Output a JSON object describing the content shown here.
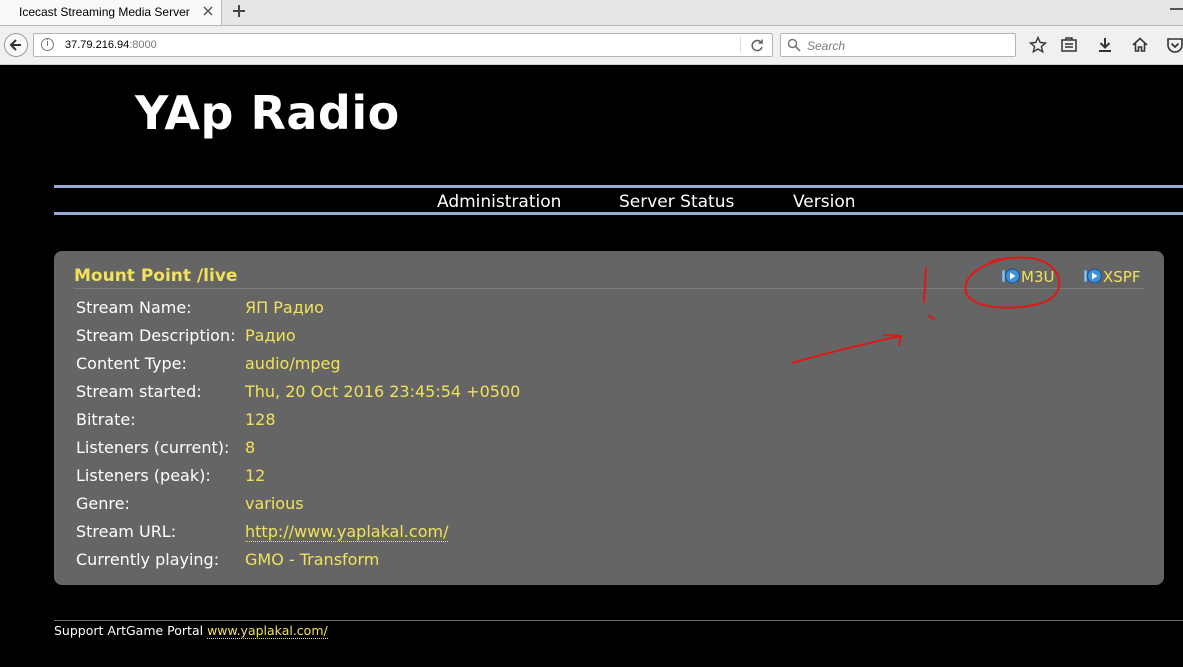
{
  "browser": {
    "tab_title": "Icecast Streaming Media Server",
    "url_host": "37.79.216.94",
    "url_port": ":8000",
    "search_placeholder": "Search"
  },
  "site": {
    "title": "YAp Radio",
    "nav": {
      "administration": "Administration",
      "server_status": "Server Status",
      "version": "Version"
    }
  },
  "mount": {
    "title": "Mount Point /live",
    "m3u_label": "M3U",
    "xspf_label": "XSPF",
    "rows": [
      {
        "label": "Stream Name:",
        "value": "ЯП Радио"
      },
      {
        "label": "Stream Description:",
        "value": "Радио"
      },
      {
        "label": "Content Type:",
        "value": "audio/mpeg"
      },
      {
        "label": "Stream started:",
        "value": "Thu, 20 Oct 2016 23:45:54 +0500"
      },
      {
        "label": "Bitrate:",
        "value": "128"
      },
      {
        "label": "Listeners (current):",
        "value": "8"
      },
      {
        "label": "Listeners (peak):",
        "value": "12"
      },
      {
        "label": "Genre:",
        "value": "various"
      },
      {
        "label": "Stream URL:",
        "value": "http://www.yaplakal.com/"
      },
      {
        "label": "Currently playing:",
        "value": "GMO - Transform"
      }
    ]
  },
  "footer": {
    "text": "Support ArtGame Portal ",
    "link": "www.yaplakal.com/"
  },
  "colors": {
    "accent_yellow": "#f2e25b",
    "panel_gray": "#656565",
    "nav_line": "#9aa9d4",
    "annotation_red": "#e01818"
  }
}
